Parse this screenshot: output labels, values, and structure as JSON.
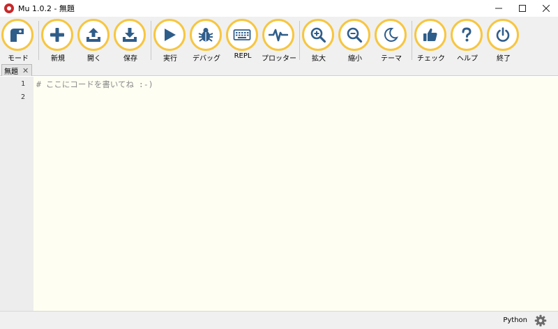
{
  "window": {
    "title": "Mu 1.0.2 - 無題",
    "minimize_icon": "minimize-icon",
    "maximize_icon": "maximize-icon",
    "close_icon": "close-icon"
  },
  "toolbar": {
    "accent_color": "#f7c640",
    "icon_color": "#2f5d8a",
    "buttons": [
      {
        "label": "モード",
        "icon": "mode-icon"
      },
      {
        "label": "新規",
        "icon": "plus-icon"
      },
      {
        "label": "開く",
        "icon": "upload-icon"
      },
      {
        "label": "保存",
        "icon": "download-icon"
      },
      {
        "label": "実行",
        "icon": "play-icon"
      },
      {
        "label": "デバッグ",
        "icon": "bug-icon"
      },
      {
        "label": "REPL",
        "icon": "keyboard-icon"
      },
      {
        "label": "プロッター",
        "icon": "pulse-icon"
      },
      {
        "label": "拡大",
        "icon": "zoom-in-icon"
      },
      {
        "label": "縮小",
        "icon": "zoom-out-icon"
      },
      {
        "label": "テーマ",
        "icon": "moon-icon"
      },
      {
        "label": "チェック",
        "icon": "thumbs-up-icon"
      },
      {
        "label": "ヘルプ",
        "icon": "question-icon"
      },
      {
        "label": "終了",
        "icon": "power-icon"
      }
    ]
  },
  "tabs": [
    {
      "label": "無題",
      "close_icon": "close-icon"
    }
  ],
  "editor": {
    "background": "#fffef2",
    "line_numbers": [
      "1",
      "2"
    ],
    "lines": [
      "# ここにコードを書いてね :-)",
      ""
    ]
  },
  "status": {
    "mode": "Python",
    "settings_icon": "gear-icon"
  }
}
